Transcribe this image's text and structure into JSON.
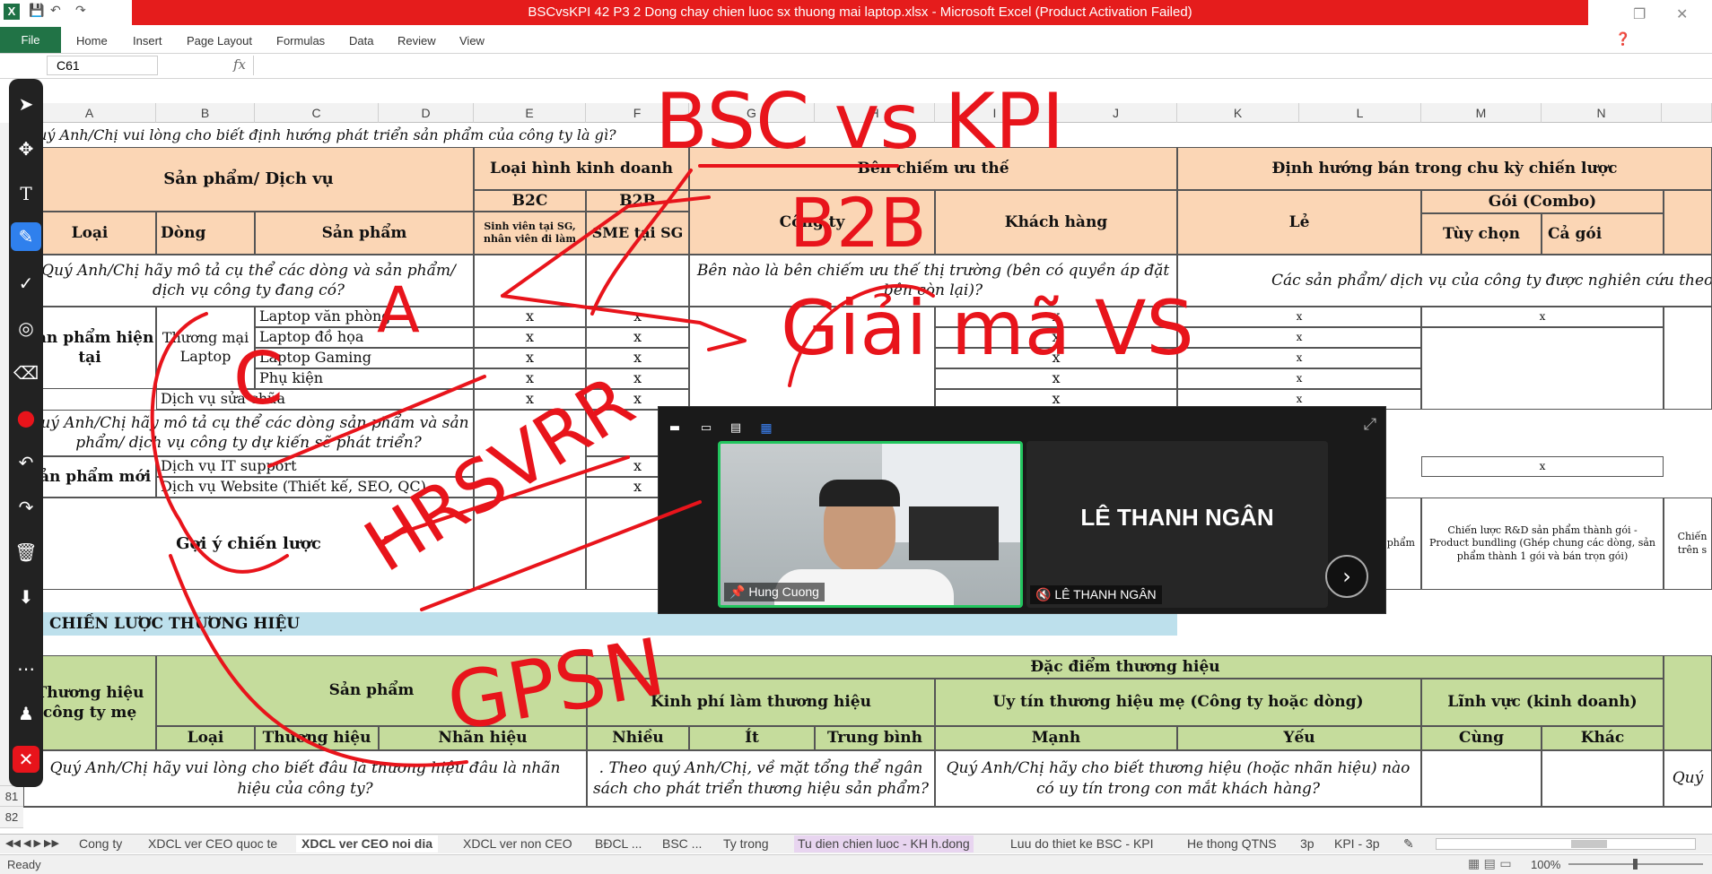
{
  "window": {
    "title": "BSCvsKPI 42 P3 2 Dong chay chien luoc sx thuong mai laptop.xlsx - Microsoft Excel (Product Activation Failed)",
    "logo": "X"
  },
  "ribbon": {
    "file": "File",
    "tabs": [
      "Home",
      "Insert",
      "Page Layout",
      "Formulas",
      "Data",
      "Review",
      "View"
    ]
  },
  "formula": {
    "cell_ref": "C61",
    "fx": "fx",
    "value": ""
  },
  "columns": [
    "A",
    "B",
    "C",
    "D",
    "E",
    "F",
    "G",
    "H",
    "I",
    "J",
    "K",
    "L",
    "M",
    "N"
  ],
  "rows": {
    "r81": "81",
    "r82": "82"
  },
  "sheet": {
    "q1": "Quý Anh/Chị vui lòng cho biết định hướng phát triển sản phẩm của công ty là gì?",
    "h_sp": "Sản phẩm/ Dịch vụ",
    "h_loaihinh": "Loại hình kinh doanh",
    "h_ben": "Bên chiếm ưu thế",
    "h_dinhhuong": "Định hướng bán trong chu kỳ chiến lược",
    "h_b2c": "B2C",
    "h_b2c_sub": "Sinh viên tại SG, nhân viên đi làm",
    "h_b2b": "B2B",
    "h_b2b_sub": "SME tại SG",
    "h_congty": "Công ty",
    "h_khachhang": "Khách hàng",
    "h_le": "Lẻ",
    "h_goi": "Gói (Combo)",
    "h_tuychon": "Tùy chọn",
    "h_cagoi": "Cả gói",
    "h_loai": "Loại",
    "h_dong": "Dòng",
    "h_sanpham": "Sản phẩm",
    "q2": "Quý Anh/Chị hãy mô tả cụ thể các dòng và sản phẩm/ dịch vụ công ty đang có?",
    "q3": "Bên nào là bên chiếm ưu thế thị trường (bên có quyền áp đặt bên còn lại)?",
    "q4": "Các sản phẩm/ dịch vụ của công ty được nghiên cứu theo h",
    "sp_hientai": "Sản phẩm hiện tại",
    "thuongmai": "Thương mại Laptop",
    "items": [
      "Laptop văn phòng",
      "Laptop đồ họa",
      "Laptop Gaming",
      "Phụ kiện"
    ],
    "suachua": "Dịch vụ sửa chữa",
    "x": "x",
    "q5": "Quý Anh/Chị hãy mô tả cụ thể các dòng sản phẩm và sản phẩm/ dịch vụ công ty dự kiến sẽ phát triển?",
    "sp_moi": "Sản phẩm mới",
    "it_support": "Dịch vụ IT support",
    "website": "Dịch vụ Website (Thiết kế, SEO, QC)",
    "goiy": "Gợi ý chiến lược",
    "goiy_text": "Chiến lược R&D sản phẩm thành gói - Product bundling (Ghép chung các dòng, sản phẩm thành 1 gói và bán trọn gói)",
    "goiy_left": "t - phẩm",
    "goiy_right": "Chiến trên s",
    "cl_th": "CHIẾN LƯỢC THƯƠNG HIỆU",
    "th_me": "Thương hiệu công ty mẹ",
    "th_sanpham": "Sản phẩm",
    "th_dacdiem": "Đặc điểm thương hiệu",
    "th_kinhphi": "Kinh phí làm thương hiệu",
    "th_uytin": "Uy tín thương hiệu mẹ (Công ty hoặc dòng)",
    "th_linhvuc": "Lĩnh vực (kinh doanh)",
    "th_loai": "Loại",
    "th_thuonghieu": "Thương hiệu",
    "th_nhanhieu": "Nhãn hiệu",
    "th_nhieu": "Nhiều",
    "th_it": "Ít",
    "th_trungbinh": "Trung bình",
    "th_manh": "Mạnh",
    "th_yeu": "Yếu",
    "th_cung": "Cùng",
    "th_khac": "Khác",
    "q6": "Quý Anh/Chị hãy vui lòng cho biết đâu là thương hiệu đâu là nhãn hiệu của công ty?",
    "q7": ". Theo quý Anh/Chị, về mặt tổng thể ngân sách cho phát triển thương hiệu sản phẩm?",
    "q8": "Quý Anh/Chị hãy cho biết thương hiệu (hoặc nhãn hiệu) nào có uy tín trong con mắt khách hàng?",
    "q9": "Quý"
  },
  "zoom": {
    "self_name": "Hung Cuong",
    "other_big": "LÊ THANH NGÂN",
    "other_name": "LÊ THANH NGÂN"
  },
  "annotations": {
    "t1": "BSC vs KPI",
    "t2": "B2B",
    "t3": "Giải mã VS",
    "t4": "HRSVRR",
    "t5": "GPSN",
    "t6": "A",
    "t7": "C"
  },
  "sheets": [
    "Cong ty",
    "XDCL ver CEO quoc te",
    "XDCL ver CEO noi dia",
    "XDCL ver non CEO",
    "BĐCL ...",
    "BSC ...",
    "Ty trong",
    "Tu dien chien luoc - KH h.dong",
    "Luu do thiet ke BSC - KPI",
    "He thong QTNS",
    "3p",
    "KPI - 3p"
  ],
  "status": {
    "ready": "Ready",
    "zoom": "100%"
  },
  "colors": {
    "excel_green": "#217346",
    "title_red": "#e51c1c",
    "peach": "#fbd6b5",
    "green": "#c5dc9c",
    "blue": "#bde0ec",
    "ink": "#e8141b"
  }
}
